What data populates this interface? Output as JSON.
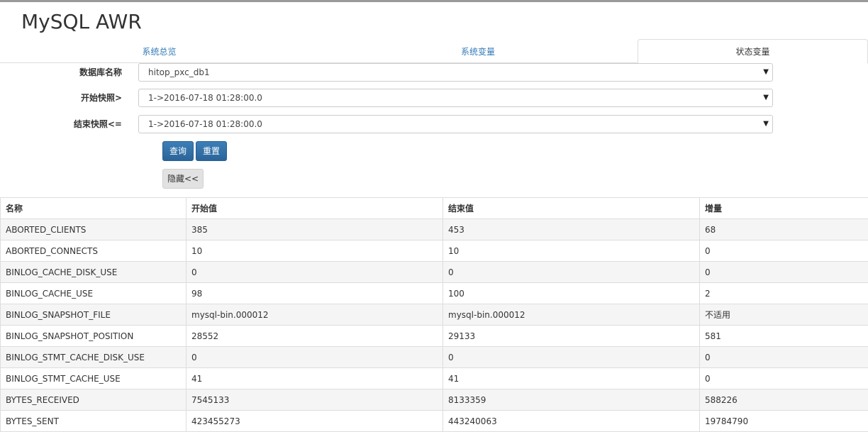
{
  "app": {
    "title": "MySQL AWR"
  },
  "tabs": [
    {
      "label": "系统总览"
    },
    {
      "label": "系统变量"
    },
    {
      "label": "状态变量"
    }
  ],
  "form": {
    "db_label": "数据库名称",
    "db_value": "hitop_pxc_db1",
    "start_label": "开始快照>",
    "start_value": "1->2016-07-18 01:28:00.0",
    "end_label": "结束快照<=",
    "end_value": "1->2016-07-18 01:28:00.0",
    "query_label": "查询",
    "reset_label": "重置",
    "hide_label": "隐藏<<"
  },
  "table": {
    "headers": [
      "名称",
      "开始值",
      "结束值",
      "增量"
    ],
    "rows": [
      [
        "ABORTED_CLIENTS",
        "385",
        "453",
        "68"
      ],
      [
        "ABORTED_CONNECTS",
        "10",
        "10",
        "0"
      ],
      [
        "BINLOG_CACHE_DISK_USE",
        "0",
        "0",
        "0"
      ],
      [
        "BINLOG_CACHE_USE",
        "98",
        "100",
        "2"
      ],
      [
        "BINLOG_SNAPSHOT_FILE",
        "mysql-bin.000012",
        "mysql-bin.000012",
        "不适用"
      ],
      [
        "BINLOG_SNAPSHOT_POSITION",
        "28552",
        "29133",
        "581"
      ],
      [
        "BINLOG_STMT_CACHE_DISK_USE",
        "0",
        "0",
        "0"
      ],
      [
        "BINLOG_STMT_CACHE_USE",
        "41",
        "41",
        "0"
      ],
      [
        "BYTES_RECEIVED",
        "7545133",
        "8133359",
        "588226"
      ],
      [
        "BYTES_SENT",
        "423455273",
        "443240063",
        "19784790"
      ]
    ]
  }
}
